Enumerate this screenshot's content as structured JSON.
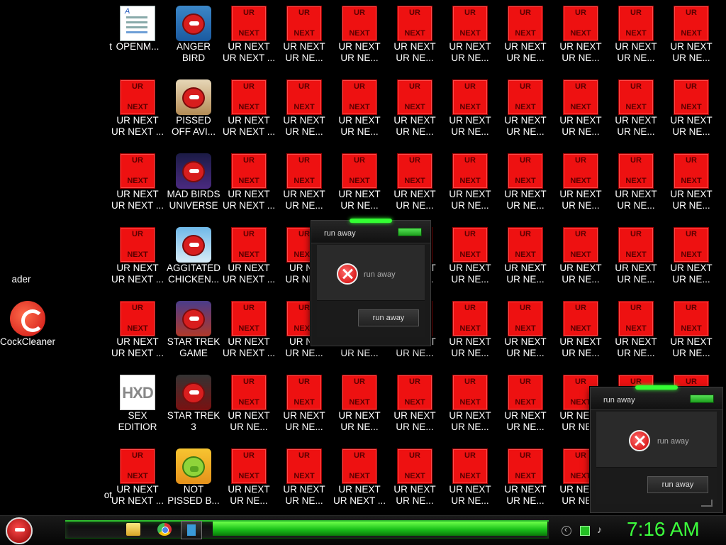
{
  "desktop": {
    "col0": {
      "partial1": "t",
      "partial2": "ader",
      "partial3": "ot",
      "ccleaner": "CockCleaner"
    },
    "col1": [
      "UR NEXT\nUR NEXT ...",
      "UR NEXT\nUR NEXT ...",
      "UR NEXT\nUR NEXT ...",
      "SEX\nEDITIOR",
      "UR NEXT\nUR NEXT ..."
    ],
    "col1_top": "OPENM...",
    "col2": [
      "ANGER\nBIRD",
      "PISSED\nOFF AVI...",
      "MAD BIRDS\nUNIVERSE",
      "AGGITATED\nCHICKEN...",
      "STAR TREK\nGAME",
      "STAR TREK\n3",
      "NOT\nPISSED B..."
    ],
    "ur_top": "UR",
    "ur_bottom": "NEXT",
    "ur_label_a": "UR NEXT\nUR NEXT ...",
    "ur_label_b": "UR NEXT\nUR NE...",
    "ur_label_c": "UR NE\nUR NE...",
    "ur_label_d": "UR NE\nUR NE",
    "hxd": "HXD"
  },
  "dialogs": [
    {
      "title": "run away",
      "message": "run away",
      "button": "run away"
    },
    {
      "title": "run away",
      "message": "run away",
      "button": "run away"
    }
  ],
  "taskbar": {
    "clock": "7:16 AM"
  }
}
